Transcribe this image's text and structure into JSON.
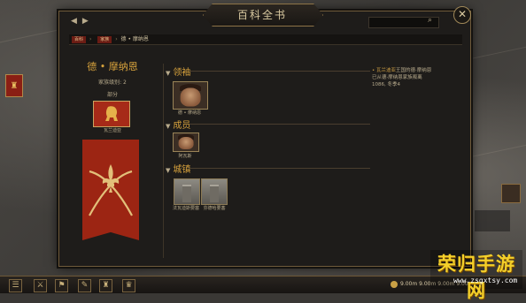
{
  "app": {
    "title": "百科全书"
  },
  "search": {
    "placeholder": ""
  },
  "breadcrumb": {
    "tag": "百科",
    "sep1": "›",
    "item1": "家族",
    "sep2": "›",
    "item2": "德 • 摩纳恩"
  },
  "clan": {
    "name": "德 • 摩纳恩",
    "tier_label": "家族级别: 2",
    "type_label": "部分",
    "kingdom_label": "瓦兰迪亚"
  },
  "sections": {
    "leader": {
      "title": "领袖",
      "members": [
        {
          "name": "德 • 摩纳恩"
        }
      ]
    },
    "members": {
      "title": "成员",
      "members": [
        {
          "name": "阿瓦斯"
        }
      ]
    },
    "settlements": {
      "title": "城镇",
      "items": [
        {
          "name": "法瓦迪斯要塞"
        },
        {
          "name": "芬德哈要塞"
        }
      ]
    }
  },
  "note": {
    "line1_link": "瓦兰迪亚",
    "line1_rest": "王国的德·摩纳恩",
    "line2": "已从德·摩纳恩家族叛离",
    "line3": "1086, 冬季4"
  },
  "status": {
    "gold": "9.00m",
    "readout": "9.00m  9.00m  9.00m  9.00m"
  },
  "watermark": {
    "text": "荣归手游网",
    "url": "www.zsgxtsy.com"
  },
  "icons": {
    "nav_back": "arrow-left-icon",
    "nav_forward": "arrow-right-icon",
    "search": "search-icon",
    "close": "close-icon",
    "section_chevron": "chevron-down-icon",
    "banner_emblem": "fleur-de-lis-icon",
    "kingdom_emblem": "lion-icon"
  },
  "colors": {
    "accent_gold": "#d6a13c",
    "banner_red": "#9c2513",
    "panel_bg": "#1e1c1a",
    "border": "#6f5a3a"
  }
}
